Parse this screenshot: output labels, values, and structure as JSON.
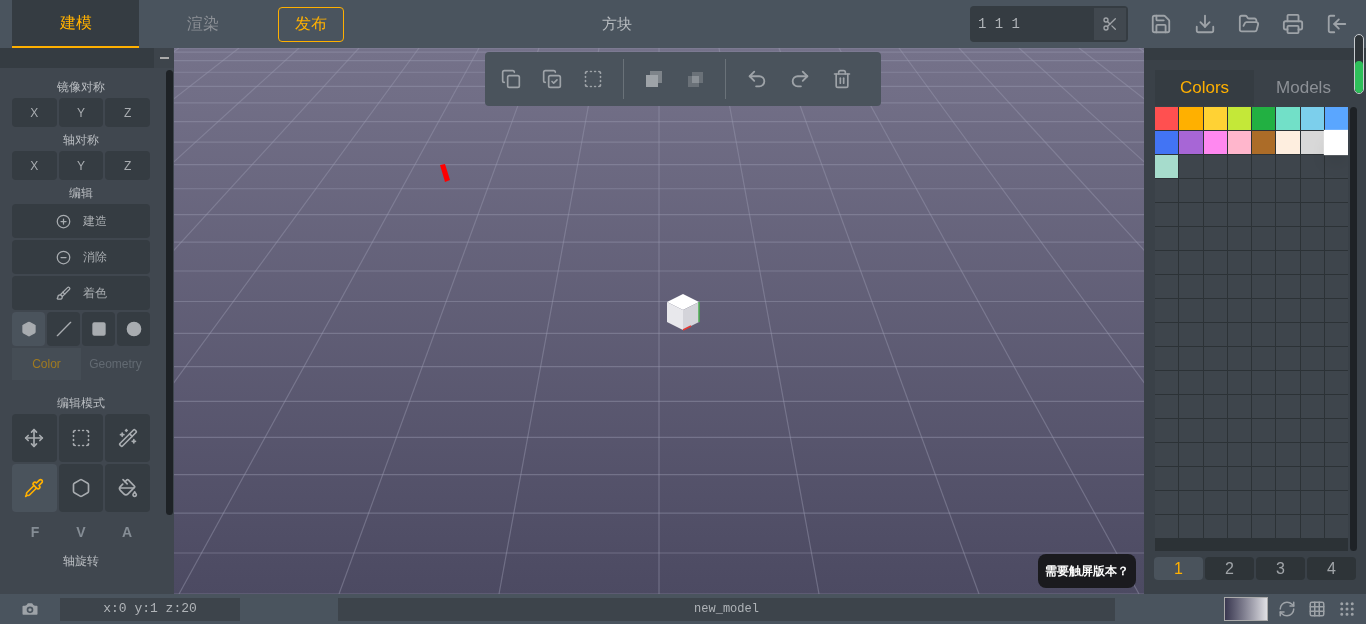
{
  "top_tabs": [
    {
      "label": "建模",
      "selected": true
    },
    {
      "label": "渲染",
      "selected": false
    }
  ],
  "publish_button": "发布",
  "title": "方块",
  "size_field": {
    "value": "1 1 1"
  },
  "mirror_symmetry": {
    "title": "镜像对称",
    "buttons": [
      "X",
      "Y",
      "Z"
    ]
  },
  "axis_symmetry": {
    "title": "轴对称",
    "buttons": [
      "X",
      "Y",
      "Z"
    ]
  },
  "edit": {
    "title": "编辑",
    "actions": [
      {
        "kind": "build",
        "label": "建造"
      },
      {
        "kind": "erase",
        "label": "消除"
      },
      {
        "kind": "paint",
        "label": "着色"
      }
    ]
  },
  "shape_tools": [
    {
      "kind": "cube",
      "selected": true
    },
    {
      "kind": "line",
      "selected": false
    },
    {
      "kind": "square",
      "selected": false
    },
    {
      "kind": "circle",
      "selected": false
    }
  ],
  "panel_tabs": [
    {
      "label": "Color",
      "selected": true
    },
    {
      "label": "Geometry",
      "selected": false
    }
  ],
  "edit_mode": {
    "title": "编辑模式",
    "tools": [
      {
        "kind": "move",
        "selected": false
      },
      {
        "kind": "select",
        "selected": false
      },
      {
        "kind": "wand",
        "selected": false
      },
      {
        "kind": "pipette",
        "selected": true
      },
      {
        "kind": "delete",
        "selected": false
      },
      {
        "kind": "fill",
        "selected": false
      }
    ]
  },
  "fva_buttons": [
    "F",
    "V",
    "A"
  ],
  "axis_rotation": {
    "title": "轴旋转"
  },
  "right_tabs": [
    {
      "label": "Colors",
      "selected": true
    },
    {
      "label": "Models",
      "selected": false
    }
  ],
  "palette": [
    {
      "color": "#ff5050",
      "selected": false
    },
    {
      "color": "#ffb000",
      "selected": false
    },
    {
      "color": "#ffd234",
      "selected": false
    },
    {
      "color": "#c4e838",
      "selected": false
    },
    {
      "color": "#22b042",
      "selected": false
    },
    {
      "color": "#72e0c8",
      "selected": false
    },
    {
      "color": "#7ccfec",
      "selected": false
    },
    {
      "color": "#5aa6ff",
      "selected": false
    },
    {
      "color": "#4274f4",
      "selected": false
    },
    {
      "color": "#a766d6",
      "selected": false
    },
    {
      "color": "#ff88f0",
      "selected": false
    },
    {
      "color": "#ffb6cc",
      "selected": false
    },
    {
      "color": "#ac6c28",
      "selected": false
    },
    {
      "color": "#feeedf",
      "selected": false
    },
    {
      "color": "#d8d8d8",
      "selected": false
    },
    {
      "color": "#ffffff",
      "selected": true
    },
    {
      "color": "#a6dccc",
      "selected": false
    }
  ],
  "pages": [
    {
      "label": "1",
      "selected": true
    },
    {
      "label": "2",
      "selected": false
    },
    {
      "label": "3",
      "selected": false
    },
    {
      "label": "4",
      "selected": false
    }
  ],
  "zoom_slider": {
    "level": 0.55
  },
  "tooltip": "需要触屏版本？",
  "status_bar": {
    "coordinates": "x:0 y:1 z:20",
    "file_name": "new_model"
  }
}
